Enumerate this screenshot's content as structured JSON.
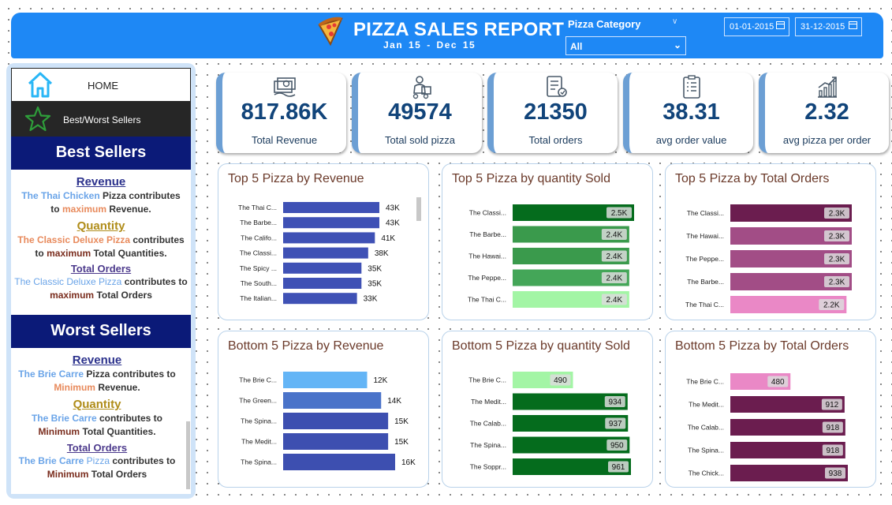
{
  "header": {
    "title": "PIZZA SALES REPORT",
    "subtitle": "Jan 15  -  Dec 15",
    "category_label": "Pizza Category",
    "category_value": "All",
    "date_start": "01-01-2015",
    "date_end": "31-12-2015",
    "colors": {
      "header_bg": "#1e88f5"
    }
  },
  "sidebar": {
    "home_label": "HOME",
    "bw_label": "Best/Worst Sellers",
    "best": {
      "heading": "Best Sellers",
      "revenue_heading": "Revenue",
      "revenue_pizza": "The Thai Chicken",
      "revenue_line1_tail": " Pizza contributes",
      "revenue_line2_pre": "to ",
      "revenue_word": "maximum",
      "revenue_line2_tail": " Revenue.",
      "quantity_heading": "Quantity",
      "quantity_pizza": "The Classic Deluxe Pizza",
      "quantity_line1_tail": " contributes",
      "quantity_line2_pre": "to ",
      "quantity_word": "maximum",
      "quantity_line2_tail": " Total Quantities.",
      "orders_heading": "Total Orders",
      "orders_pizza": "The Classic Deluxe Pizza",
      "orders_line1_tail": " contributes to",
      "orders_word": "maximum",
      "orders_line2_tail": " Total Orders"
    },
    "worst": {
      "heading": "Worst Sellers",
      "revenue_heading": "Revenue",
      "revenue_pizza": "The Brie Carre",
      "revenue_line1_tail": " Pizza contributes to",
      "revenue_word": "Minimum",
      "revenue_line2_tail": " Revenue.",
      "quantity_heading": "Quantity",
      "quantity_pizza": "The Brie Carre",
      "quantity_line1_tail": " contributes to",
      "quantity_word": "Minimum",
      "quantity_line2_tail": " Total Quantities.",
      "orders_heading": "Total Orders",
      "orders_pizza": "The Brie Carre",
      "orders_pizza_suffix": " Pizza",
      "orders_line1_tail": " contributes to",
      "orders_word": "Minimum",
      "orders_line2_tail": " Total Orders"
    }
  },
  "kpis": [
    {
      "value": "817.86K",
      "label": "Total Revenue",
      "icon": "money-icon"
    },
    {
      "value": "49574",
      "label": "Total sold pizza",
      "icon": "delivery-icon"
    },
    {
      "value": "21350",
      "label": "Total orders",
      "icon": "order-list-icon"
    },
    {
      "value": "38.31",
      "label": "avg order value",
      "icon": "clipboard-icon"
    },
    {
      "value": "2.32",
      "label": "avg pizza per order",
      "icon": "growth-chart-icon"
    }
  ],
  "chart_data": [
    {
      "type": "bar",
      "orientation": "horizontal",
      "title": "Top 5 Pizza by Revenue",
      "categories": [
        "The Thai C...",
        "The Barbe...",
        "The Califo...",
        "The Classi...",
        "The Spicy ...",
        "The South...",
        "The Italian..."
      ],
      "values": [
        43,
        43,
        41,
        38,
        35,
        35,
        33
      ],
      "value_labels": [
        "43K",
        "43K",
        "41K",
        "38K",
        "35K",
        "35K",
        "33K"
      ],
      "colors": [
        "#3f51b5"
      ],
      "label_style": "outside",
      "xmax": 43
    },
    {
      "type": "bar",
      "orientation": "horizontal",
      "title": "Top 5 Pizza by quantity Sold",
      "categories": [
        "The Classi...",
        "The Barbe...",
        "The Hawai...",
        "The Peppe...",
        "The Thai C..."
      ],
      "values": [
        2.5,
        2.4,
        2.4,
        2.4,
        2.4
      ],
      "value_labels": [
        "2.5K",
        "2.4K",
        "2.4K",
        "2.4K",
        "2.4K"
      ],
      "colors": [
        "#056c1d",
        "#3a9a4c",
        "#3a9a4c",
        "#44a658",
        "#a3f5a5"
      ],
      "label_style": "inside",
      "xmax": 2.5
    },
    {
      "type": "bar",
      "orientation": "horizontal",
      "title": "Top 5 Pizza by Total Orders",
      "categories": [
        "The Classi...",
        "The Hawai...",
        "The Peppe...",
        "The Barbe...",
        "The Thai C..."
      ],
      "values": [
        2.3,
        2.3,
        2.3,
        2.3,
        2.2
      ],
      "value_labels": [
        "2.3K",
        "2.3K",
        "2.3K",
        "2.3K",
        "2.2K"
      ],
      "colors": [
        "#6b1d4f",
        "#a24d86",
        "#a24d86",
        "#a24d86",
        "#ea88c6"
      ],
      "label_style": "inside",
      "xmax": 2.3
    },
    {
      "type": "bar",
      "orientation": "horizontal",
      "title": "Bottom 5 Pizza by Revenue",
      "categories": [
        "The Brie C...",
        "The Green...",
        "The Spina...",
        "The Medit...",
        "The Spina..."
      ],
      "values": [
        12,
        14,
        15,
        15,
        16
      ],
      "value_labels": [
        "12K",
        "14K",
        "15K",
        "15K",
        "16K"
      ],
      "colors": [
        "#64b5f6",
        "#4a73c9",
        "#3d4fb0",
        "#3d4fb0",
        "#3d4fb0"
      ],
      "label_style": "outside",
      "xmax": 16
    },
    {
      "type": "bar",
      "orientation": "horizontal",
      "title": "Bottom 5 Pizza by quantity Sold",
      "categories": [
        "The Brie C...",
        "The Medit...",
        "The Calab...",
        "The Spina...",
        "The Soppr..."
      ],
      "values": [
        490,
        934,
        937,
        950,
        961
      ],
      "value_labels": [
        "490",
        "934",
        "937",
        "950",
        "961"
      ],
      "colors": [
        "#a3f5a5",
        "#056c1d",
        "#056c1d",
        "#056c1d",
        "#056c1d"
      ],
      "label_style": "inside",
      "xmax": 961
    },
    {
      "type": "bar",
      "orientation": "horizontal",
      "title": "Bottom 5 Pizza by Total Orders",
      "categories": [
        "The Brie C...",
        "The Medit...",
        "The Calab...",
        "The Spina...",
        "The Chick..."
      ],
      "values": [
        480,
        912,
        918,
        918,
        938
      ],
      "value_labels": [
        "480",
        "912",
        "918",
        "918",
        "938"
      ],
      "colors": [
        "#ea88c6",
        "#6b1d4f",
        "#6b1d4f",
        "#6b1d4f",
        "#6b1d4f"
      ],
      "label_style": "inside",
      "xmax": 938
    }
  ]
}
